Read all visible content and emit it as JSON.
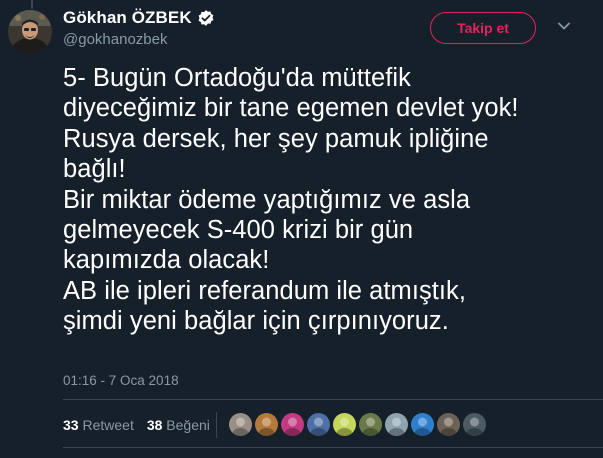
{
  "author": {
    "display_name": "Gökhan ÖZBEK",
    "handle": "@gokhanozbek",
    "verified": true
  },
  "follow_button": {
    "label": "Takip et"
  },
  "tweet": {
    "text": "5- Bugün Ortadoğu'da müttefik\ndiyeceğimiz bir tane egemen devlet yok!\nRusya dersek, her şey pamuk ipliğine\nbağlı!\nBir miktar ödeme yaptığımız ve asla\ngelmeyecek S-400 krizi bir gün\nkapımızda olacak!\nAB ile ipleri referandum ile atmıştık,\nşimdi yeni bağlar için çırpınıyoruz.",
    "timestamp": "01:16 - 7 Oca 2018"
  },
  "stats": {
    "retweet_count": "33",
    "retweet_label": "Retweet",
    "like_count": "38",
    "like_label": "Beğeni"
  },
  "likers": [
    {
      "icon": "user-avatar-icon",
      "color": "#9a8f87"
    },
    {
      "icon": "user-avatar-icon",
      "color": "#b5793b"
    },
    {
      "icon": "user-avatar-icon",
      "color": "#c23a82"
    },
    {
      "icon": "user-avatar-icon",
      "color": "#4f6fa8"
    },
    {
      "icon": "user-avatar-icon",
      "color": "#c5d65a"
    },
    {
      "icon": "user-avatar-icon",
      "color": "#6b7a4a"
    },
    {
      "icon": "user-avatar-icon",
      "color": "#8fa4b0"
    },
    {
      "icon": "user-avatar-icon",
      "color": "#2f7fcf"
    },
    {
      "icon": "user-avatar-icon",
      "color": "#6d6255"
    },
    {
      "icon": "user-avatar-icon",
      "color": "#4b5a63"
    }
  ],
  "colors": {
    "background": "#15202b",
    "text": "#ffffff",
    "muted": "#8899a6",
    "accent": "#e0245e",
    "verified": "#1da1f2",
    "divider": "#38444d"
  }
}
